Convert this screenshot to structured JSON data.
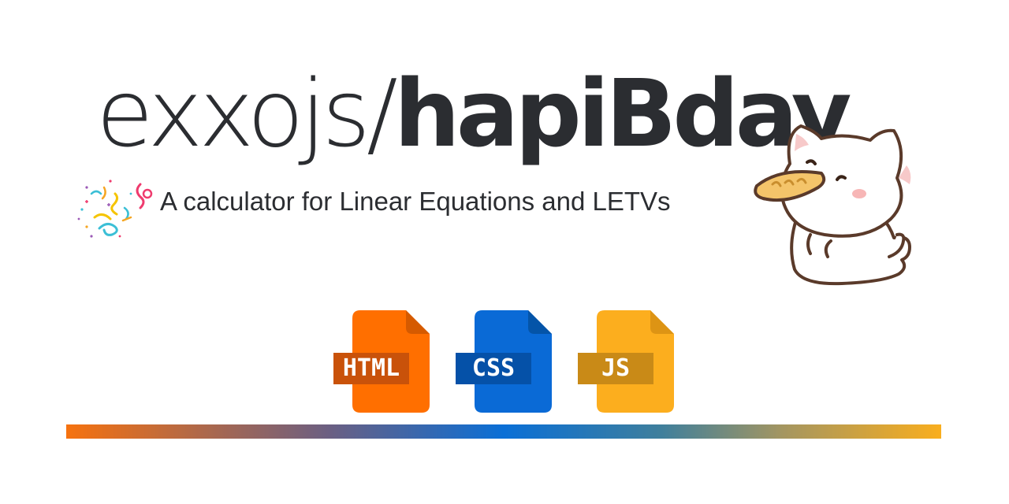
{
  "title": {
    "owner": "exxojs/",
    "repo": "hapiBday"
  },
  "subtitle": "A calculator for Linear Equations and LETVs",
  "icons": {
    "confetti": "confetti-icon",
    "mascot": "cat-eating-bread-mascot"
  },
  "tech_badges": [
    {
      "label": "HTML",
      "color": "#ff6f00",
      "fold_color": "#d55a00",
      "tag_color": "#c9520a"
    },
    {
      "label": "CSS",
      "color": "#0a6ad6",
      "fold_color": "#0454a8",
      "tag_color": "#0551a8"
    },
    {
      "label": "JS",
      "color": "#fcae1e",
      "fold_color": "#dd9414",
      "tag_color": "#c98a17"
    }
  ],
  "colors": {
    "text": "#2b2d31",
    "gradient_start": "#f6720f",
    "gradient_mid": "#0a6fd6",
    "gradient_end": "#f9ae1e"
  }
}
